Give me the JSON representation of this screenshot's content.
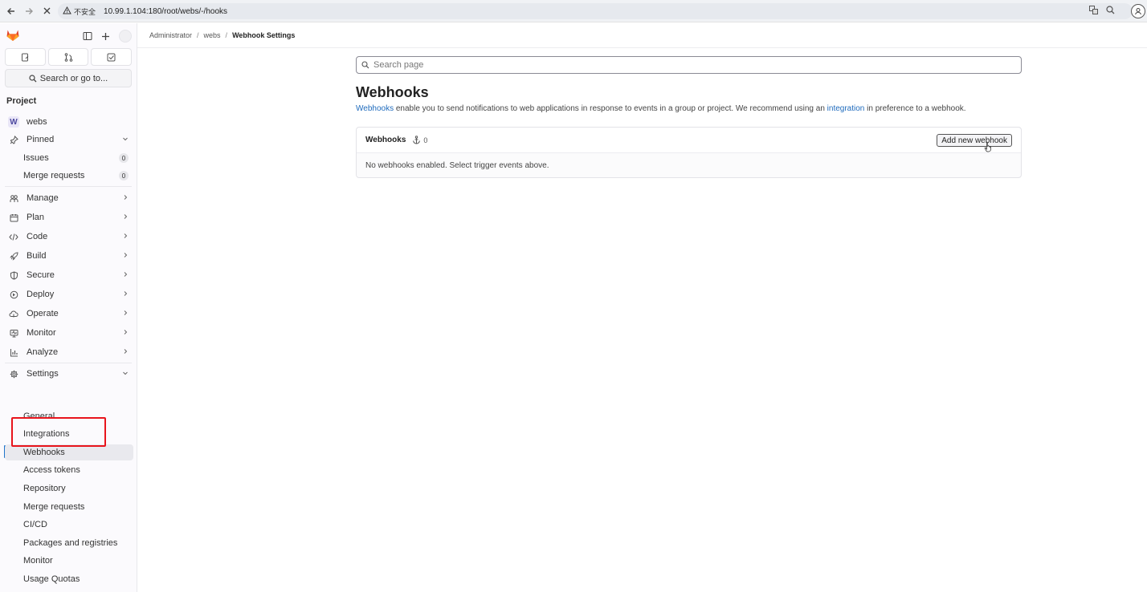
{
  "browser": {
    "insecure_label": "不安全",
    "url": "10.99.1.104:180/root/webs/-/hooks"
  },
  "sidebar": {
    "search_label": "Search or go to...",
    "section_title": "Project",
    "project_name": "webs",
    "project_initial": "W",
    "pinned": {
      "label": "Pinned",
      "items": [
        {
          "label": "Issues",
          "count": "0"
        },
        {
          "label": "Merge requests",
          "count": "0"
        }
      ]
    },
    "nav": [
      {
        "label": "Manage",
        "icon": "users-icon"
      },
      {
        "label": "Plan",
        "icon": "calendar-icon"
      },
      {
        "label": "Code",
        "icon": "code-icon"
      },
      {
        "label": "Build",
        "icon": "rocket-icon"
      },
      {
        "label": "Secure",
        "icon": "shield-icon"
      },
      {
        "label": "Deploy",
        "icon": "deploy-icon"
      },
      {
        "label": "Operate",
        "icon": "cloud-icon"
      },
      {
        "label": "Monitor",
        "icon": "monitor-icon"
      },
      {
        "label": "Analyze",
        "icon": "chart-icon"
      }
    ],
    "settings": {
      "label": "Settings",
      "items": [
        {
          "label": "General"
        },
        {
          "label": "Integrations"
        },
        {
          "label": "Webhooks"
        },
        {
          "label": "Access tokens"
        },
        {
          "label": "Repository"
        },
        {
          "label": "Merge requests"
        },
        {
          "label": "CI/CD"
        },
        {
          "label": "Packages and registries"
        },
        {
          "label": "Monitor"
        },
        {
          "label": "Usage Quotas"
        }
      ]
    }
  },
  "breadcrumb": [
    "Administrator",
    "webs",
    "Webhook Settings"
  ],
  "main": {
    "search_placeholder": "Search page",
    "title": "Webhooks",
    "description": {
      "link1": "Webhooks",
      "text1": " enable you to send notifications to web applications in response to events in a group or project. We recommend using an ",
      "link2": "integration",
      "text2": " in preference to a webhook."
    },
    "card": {
      "title": "Webhooks",
      "count": "0",
      "add_button": "Add new webhook",
      "empty_text": "No webhooks enabled. Select trigger events above."
    }
  },
  "colors": {
    "link": "#1f6bbd",
    "active_indicator": "#1f75cb",
    "annotation": "#e8141c"
  }
}
